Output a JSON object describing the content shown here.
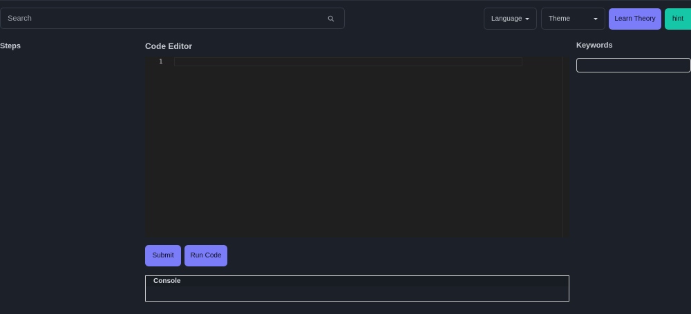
{
  "search": {
    "placeholder": "Search",
    "value": ""
  },
  "header": {
    "language_label": "Language",
    "theme_label": "Theme",
    "learn_theory_label": "Learn Theory",
    "hint_label": "hint"
  },
  "steps": {
    "title": "Steps"
  },
  "editor": {
    "title": "Code Editor",
    "line_numbers": [
      "1"
    ],
    "content": ""
  },
  "actions": {
    "submit_label": "Submit",
    "run_label": "Run Code"
  },
  "console": {
    "title": "Console",
    "output": ""
  },
  "keywords": {
    "title": "Keywords",
    "value": ""
  },
  "colors": {
    "background": "#1b2029",
    "editor_background": "#1f1f1f",
    "accent_primary": "#7b7cf8",
    "accent_hint": "#16c7a7"
  },
  "icons": {
    "search": "search-icon",
    "dropdown": "caret-down-icon"
  }
}
